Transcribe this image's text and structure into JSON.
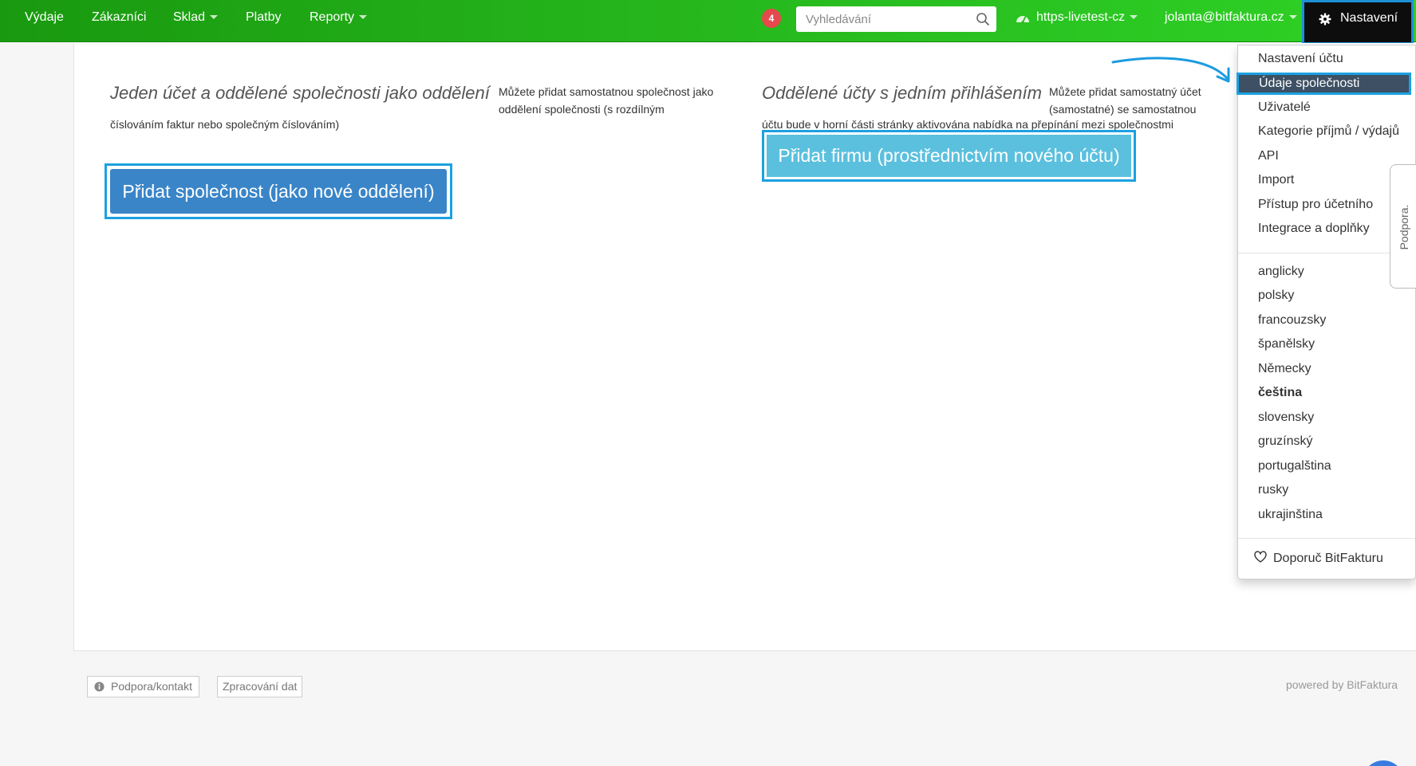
{
  "topnav": {
    "items": [
      {
        "label": "Výdaje"
      },
      {
        "label": "Zákazníci"
      },
      {
        "label": "Sklad"
      },
      {
        "label": "Platby"
      },
      {
        "label": "Reporty"
      }
    ],
    "notification_count": "4",
    "search_placeholder": "Vyhledávání",
    "account_label": "https-livetest-cz",
    "user_label": "jolanta@bitfaktura.cz",
    "settings_label": "Nastavení"
  },
  "main": {
    "left": {
      "heading": "Jeden účet a oddělené společnosti jako oddělení",
      "desc_part1": "Můžete přidat samostatnou společnost jako oddělení společnosti (s rozdílným",
      "desc_part2": "číslováním faktur nebo společným číslováním)",
      "button_label": "Přidat společnost (jako nové oddělení)"
    },
    "right": {
      "heading": "Oddělené účty s jedním přihlášením",
      "desc_part1": "Můžete přidat samostatný účet (samostatné) se samostatnou databází klientů a faktur",
      "desc_part2": "účtu bude v horní části stránky aktivována nabídka na přepínání mezi společnostmi",
      "button_label": "Přidat firmu (prostřednictvím nového účtu)"
    }
  },
  "dropdown": {
    "items": [
      {
        "label": "Nastavení účtu"
      },
      {
        "label": "Údaje společnosti"
      },
      {
        "label": "Uživatelé"
      },
      {
        "label": "Kategorie příjmů / výdajů"
      },
      {
        "label": "API"
      },
      {
        "label": "Import"
      },
      {
        "label": "Přístup pro účetního"
      },
      {
        "label": "Integrace a doplňky"
      }
    ],
    "languages": [
      {
        "label": "anglicky"
      },
      {
        "label": "polsky"
      },
      {
        "label": "francouzsky"
      },
      {
        "label": "španělsky"
      },
      {
        "label": "Německy"
      },
      {
        "label": "čeština"
      },
      {
        "label": "slovensky"
      },
      {
        "label": "gruzínský"
      },
      {
        "label": "portugalština"
      },
      {
        "label": "rusky"
      },
      {
        "label": "ukrajinština"
      }
    ],
    "recommend_label": "Doporuč BitFakturu"
  },
  "support_tab_label": "Podpora.",
  "footer": {
    "support_label": "Podpora/kontakt",
    "data_label": "Zpracování dat",
    "powered_label": "powered by BitFaktura"
  },
  "colors": {
    "nav_green": "#25b51c",
    "highlight_blue": "#1ba1e2",
    "primary_button": "#3a85c8",
    "info_button": "#5bc0de",
    "active_item_bg": "#3d5064",
    "badge_red": "#e5484d"
  }
}
